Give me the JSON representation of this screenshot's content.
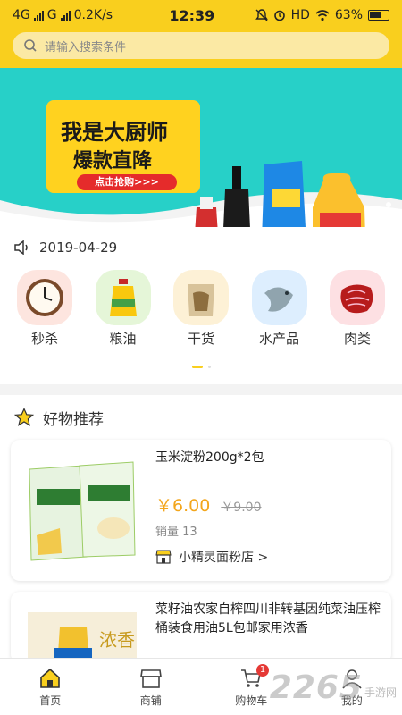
{
  "status_bar": {
    "network1": "4G",
    "network2": "G",
    "speed": "0.2K/s",
    "time": "12:39",
    "hd": "HD",
    "battery": "63%"
  },
  "search": {
    "placeholder": "请输入搜索条件"
  },
  "banner": {
    "headline_1": "我是大厨师",
    "headline_2": "爆款直降",
    "cta": "点击抢购>>>",
    "colors": {
      "bg": "#27d0c8",
      "panel": "#ffd21f",
      "cta": "#e52b2b"
    }
  },
  "notice": {
    "date": "2019-04-29"
  },
  "categories": [
    {
      "label": "秒杀",
      "icon": "clock-icon",
      "bg": "#fde5df"
    },
    {
      "label": "粮油",
      "icon": "oil-bottle-icon",
      "bg": "#e5f6d8"
    },
    {
      "label": "干货",
      "icon": "dried-goods-icon",
      "bg": "#fdf1d6"
    },
    {
      "label": "水产品",
      "icon": "fish-icon",
      "bg": "#ddeefe"
    },
    {
      "label": "肉类",
      "icon": "meat-icon",
      "bg": "#fde0e3"
    }
  ],
  "recommend": {
    "title": "好物推荐",
    "items": [
      {
        "title": "玉米淀粉200g*2包",
        "price": "￥6.00",
        "original_price": "￥9.00",
        "sales": "销量 13",
        "store": "小精灵面粉店 >"
      },
      {
        "title": "菜籽油农家自榨四川非转基因纯菜油压榨桶装食用油5L包邮家用浓香"
      }
    ]
  },
  "tabbar": {
    "items": [
      {
        "label": "首页",
        "icon": "home-icon"
      },
      {
        "label": "商铺",
        "icon": "shop-icon"
      },
      {
        "label": "购物车",
        "icon": "cart-icon",
        "badge": "1"
      },
      {
        "label": "我的",
        "icon": "user-icon"
      }
    ]
  },
  "watermark": {
    "number": "2265",
    "suffix": "手游网"
  },
  "colors": {
    "brand_yellow": "#f9cf1e",
    "price": "#f3a61c"
  }
}
